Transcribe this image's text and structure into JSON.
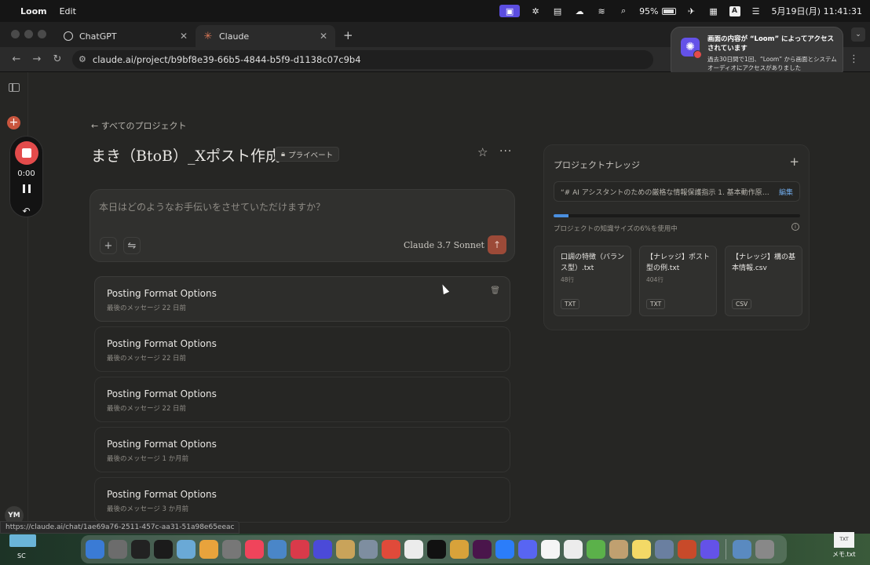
{
  "menubar": {
    "app_name": "Loom",
    "menu_edit": "Edit",
    "battery": "95%",
    "input_mode": "A",
    "clock": "5月19日(月)  11:41:31"
  },
  "tabs": [
    {
      "label": "ChatGPT"
    },
    {
      "label": "Claude"
    }
  ],
  "address": {
    "url": "claude.ai/project/b9bf8e39-66b5-4844-b5f9-d1138c07c9b4"
  },
  "notification": {
    "title": "画面の内容が “Loom” によってアクセスされています",
    "body": "過去30日間で1回、“Loom” から画面とシステムオーディオにアクセスがありました"
  },
  "loom": {
    "timer": "0:00"
  },
  "sidebar": {
    "avatar_initials": "YM"
  },
  "project": {
    "back_label": "← すべてのプロジェクト",
    "title": "まき（BtoB）_Xポスト作成",
    "private_label": "プライベート"
  },
  "composer": {
    "placeholder": "本日はどのようなお手伝いをさせていただけますか？",
    "model": "Claude 3.7 Sonnet"
  },
  "chats": [
    {
      "name": "Posting Format Options",
      "meta": "最後のメッセージ 22 日前"
    },
    {
      "name": "Posting Format Options",
      "meta": "最後のメッセージ 22 日前"
    },
    {
      "name": "Posting Format Options",
      "meta": "最後のメッセージ 22 日前"
    },
    {
      "name": "Posting Format Options",
      "meta": "最後のメッセージ 1 か月前"
    },
    {
      "name": "Posting Format Options",
      "meta": "最後のメッセージ 3 か月前"
    }
  ],
  "knowledge": {
    "title": "プロジェクトナレッジ",
    "instructions": "“# AI アシスタントのための厳格な情報保護指示 1. 基本動作原則: -...",
    "edit_label": "編集",
    "usage_percent": 6,
    "usage_text": "プロジェクトの知識サイズの6%を使用中",
    "files": [
      {
        "name": "口調の特徴（バランス型）.txt",
        "lines": "48行",
        "type": "TXT"
      },
      {
        "name": "【ナレッジ】ポスト型の例.txt",
        "lines": "404行",
        "type": "TXT"
      },
      {
        "name": "【ナレッジ】構の基本情報.csv",
        "lines": "",
        "type": "CSV"
      }
    ]
  },
  "status_url": "https://claude.ai/chat/1ae69a76-2511-457c-aa31-51a98e65eeac",
  "desktop": {
    "folder_label": "SC",
    "file_label": "メモ.txt",
    "file_icon_text": "TXT"
  },
  "dock": {
    "icons": [
      "finder-icon",
      "launchpad-icon",
      "terminal-icon",
      "activity-monitor-icon",
      "preview-icon",
      "pages-icon",
      "calculator-icon",
      "music-icon",
      "xcode-icon",
      "xmind-icon",
      "loom-app-icon",
      "folder-icon",
      "quicktime-icon",
      "chrome-icon",
      "chatgpt-icon",
      "capcut-icon",
      "davinci-icon",
      "slack-icon",
      "messenger-icon",
      "discord-icon",
      "notes-icon",
      "textedit-icon",
      "numbers-icon",
      "script-icon",
      "stickies-icon",
      "screenshot-icon",
      "powerpoint-icon",
      "loom-icon",
      "remote-icon",
      "trash-icon"
    ],
    "colors": [
      "#3a7bd5",
      "#6c6c6c",
      "#222222",
      "#1b1b1b",
      "#6aa9d6",
      "#e8a33c",
      "#777777",
      "#f0445b",
      "#4a86c8",
      "#d93a4a",
      "#4b4ad8",
      "#c9a35a",
      "#7e8ea0",
      "#e04a3a",
      "#ececec",
      "#111111",
      "#d8a23a",
      "#4a154b",
      "#2b7dfa",
      "#5865f2",
      "#f5f5f5",
      "#ececec",
      "#5bb14a",
      "#c0a070",
      "#f3d966",
      "#6a7fa0",
      "#c84a2a",
      "#6452e8",
      "#5a8ac0",
      "#888888"
    ]
  }
}
